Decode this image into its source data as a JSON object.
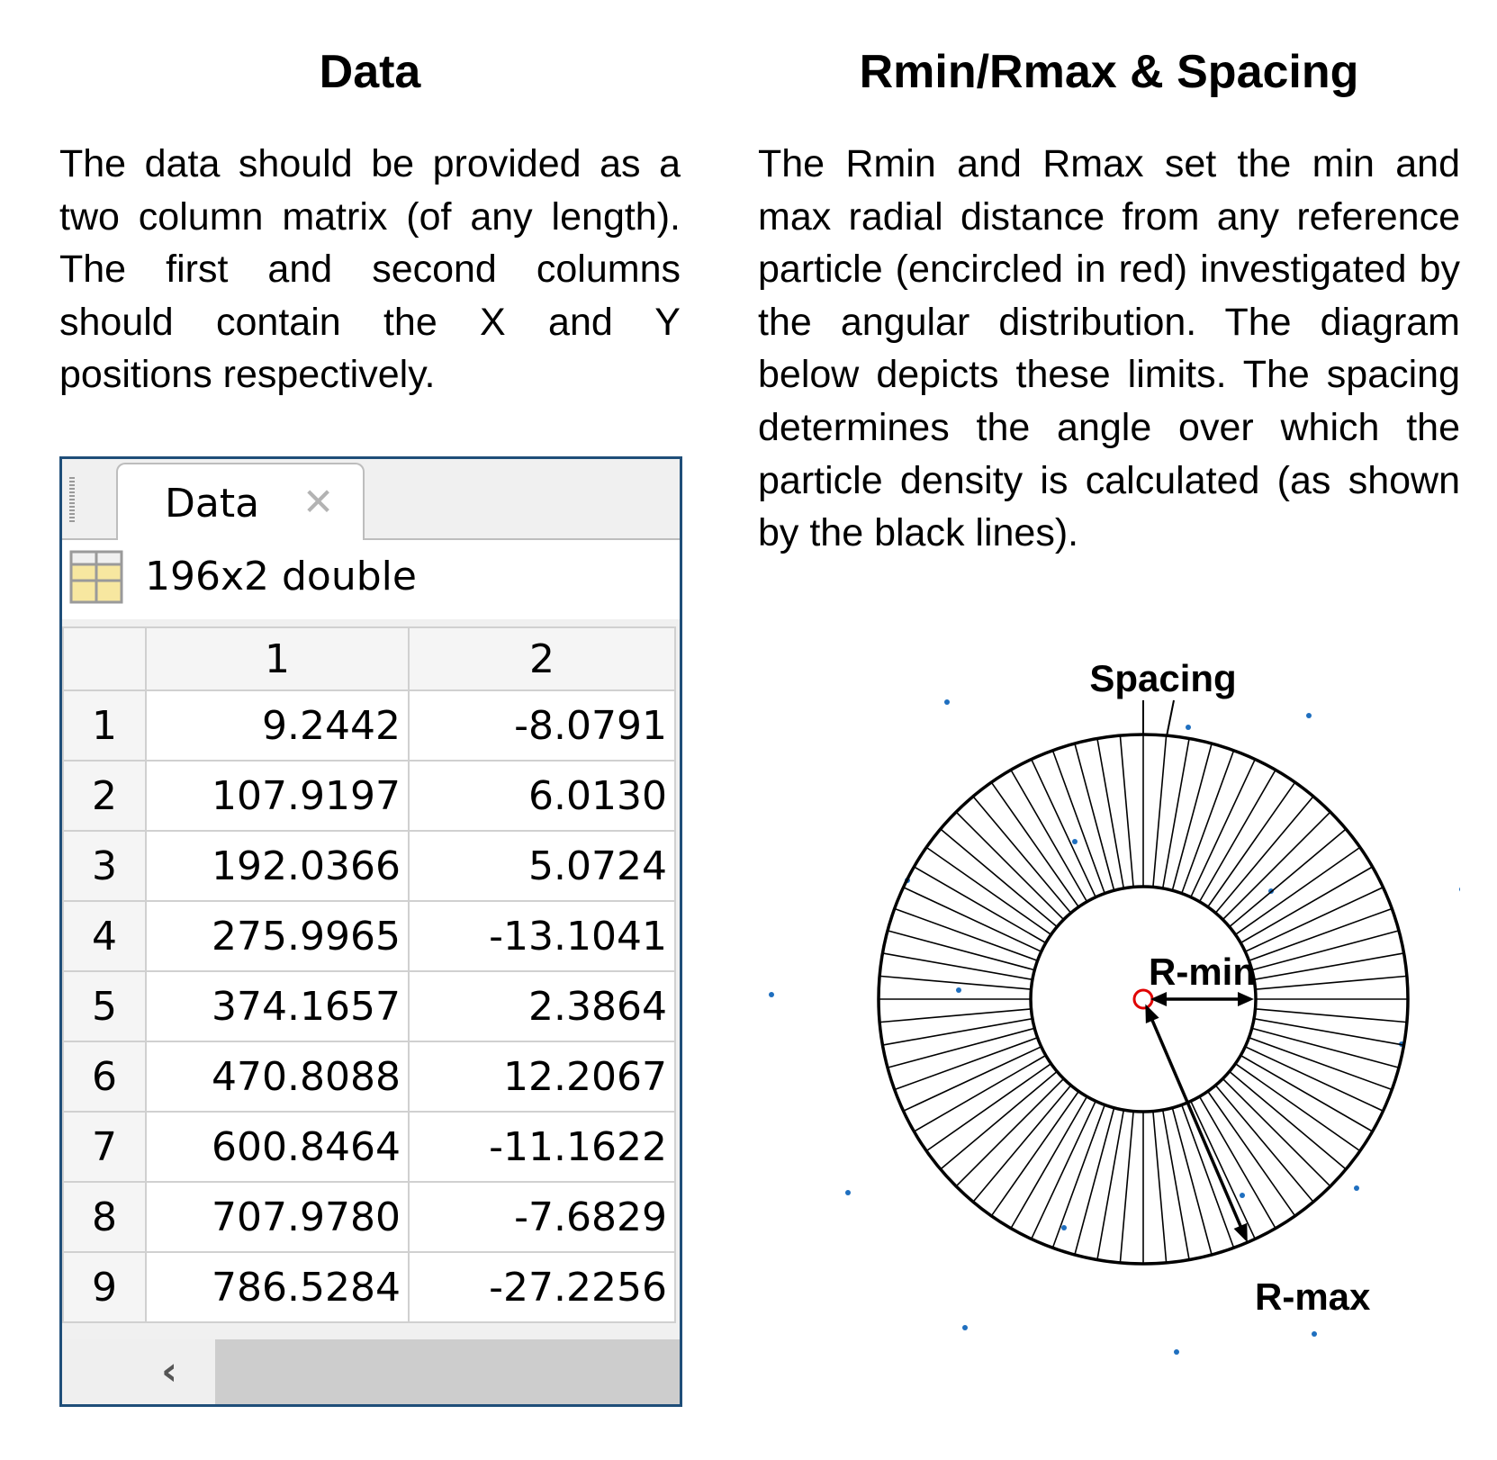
{
  "left_section": {
    "title": "Data",
    "body": "The data should be provided as a two column matrix (of any length). The first and second columns should contain the X and Y positions respectively."
  },
  "right_section": {
    "title": "Rmin/Rmax & Spacing",
    "body": "The Rmin and Rmax set the min and max radial distance from any reference particle (encircled in red) investigated by the angular distribution. The diagram below depicts these limits. The spacing determines the angle over which the particle density is calculated (as shown by the black lines)."
  },
  "variable_editor": {
    "tab_label": "Data",
    "close_icon": "close-icon",
    "grid_icon": "table-grid-icon",
    "size_label": "196x2 double",
    "columns": [
      "1",
      "2"
    ],
    "rows": [
      {
        "index": "1",
        "c1": "9.2442",
        "c2": "-8.0791"
      },
      {
        "index": "2",
        "c1": "107.9197",
        "c2": "6.0130"
      },
      {
        "index": "3",
        "c1": "192.0366",
        "c2": "5.0724"
      },
      {
        "index": "4",
        "c1": "275.9965",
        "c2": "-13.1041"
      },
      {
        "index": "5",
        "c1": "374.1657",
        "c2": "2.3864"
      },
      {
        "index": "6",
        "c1": "470.8088",
        "c2": "12.2067"
      },
      {
        "index": "7",
        "c1": "600.8464",
        "c2": "-11.1622"
      },
      {
        "index": "8",
        "c1": "707.9780",
        "c2": "-7.6829"
      },
      {
        "index": "9",
        "c1": "786.5284",
        "c2": "-27.2256"
      }
    ],
    "scroll_left_icon": "chevron-left-icon"
  },
  "diagram": {
    "spacing_label": "Spacing",
    "rmin_label": "R-min",
    "rmax_label": "R-max",
    "spoke_count": 72,
    "colors": {
      "lines": "#000000",
      "reference": "#e00000",
      "particles": "#1f6fbf",
      "window_border": "#1f4e79"
    }
  }
}
